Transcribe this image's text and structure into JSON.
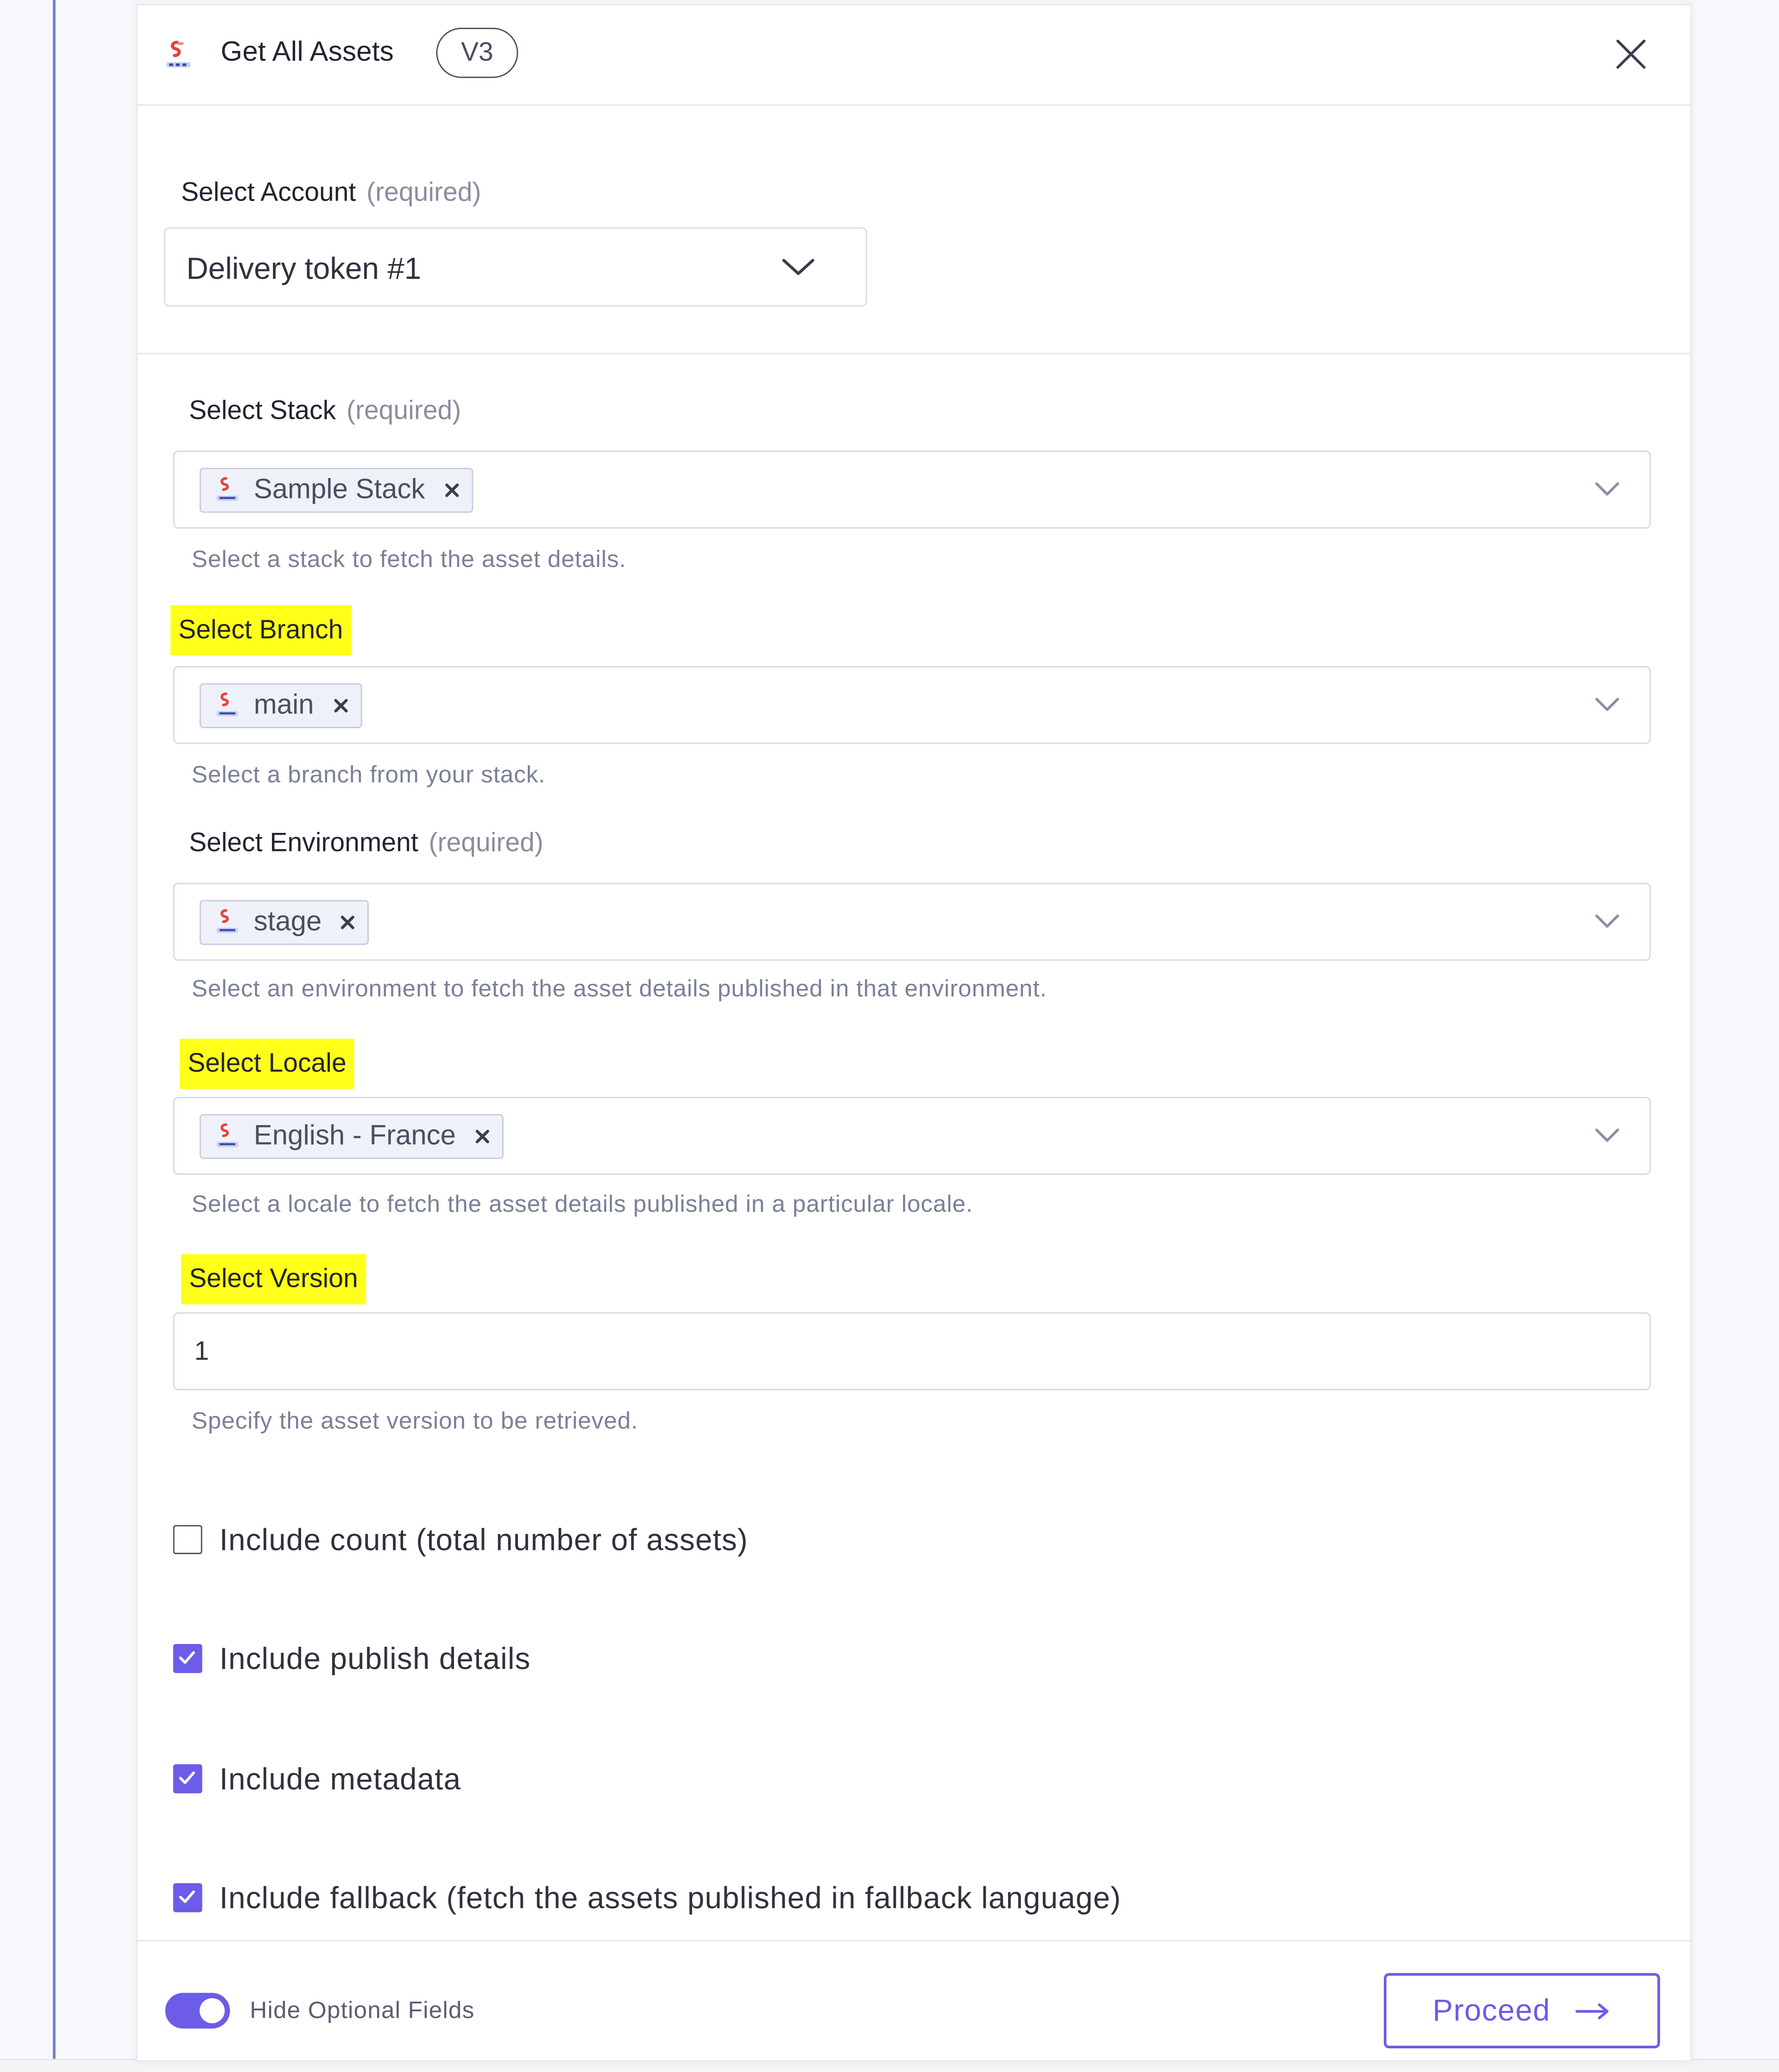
{
  "app": {
    "title": "Get All Assets",
    "version_badge": "V3"
  },
  "account": {
    "label": "Select Account",
    "required": "(required)",
    "value": "Delivery token #1"
  },
  "stack": {
    "label": "Select Stack",
    "required": "(required)",
    "chip": "Sample Stack",
    "help": "Select a stack to fetch the asset details."
  },
  "branch": {
    "label": "Select Branch",
    "chip": "main",
    "help": "Select a branch from your stack."
  },
  "environment": {
    "label": "Select Environment",
    "required": "(required)",
    "chip": "stage",
    "help": "Select an environment to fetch the asset details published in that environment."
  },
  "locale": {
    "label": "Select Locale",
    "chip": "English - France",
    "help": "Select a locale to fetch the asset details published in a particular locale."
  },
  "version": {
    "label": "Select Version",
    "value": "1",
    "help": "Specify the asset version to be retrieved."
  },
  "options": [
    {
      "label": "Include count (total number of assets)",
      "checked": false
    },
    {
      "label": "Include publish details",
      "checked": true
    },
    {
      "label": "Include metadata",
      "checked": true
    },
    {
      "label": "Include fallback (fetch the assets published in fallback language)",
      "checked": true
    }
  ],
  "footer": {
    "toggle_label": "Hide Optional Fields",
    "toggle_on": true,
    "proceed_label": "Proceed"
  },
  "colors": {
    "accent": "#6c5ce7",
    "highlight": "#ffff1a",
    "logo_red": "#e8423d",
    "rail": "#6f7fcf"
  },
  "icons": {
    "header_logo": "contentstack-logo-icon",
    "close": "close-icon",
    "dropdown": "chevron-down-icon",
    "chip_remove": "remove-x-icon",
    "checkbox": "checkmark-icon",
    "proceed": "arrow-right-icon"
  }
}
